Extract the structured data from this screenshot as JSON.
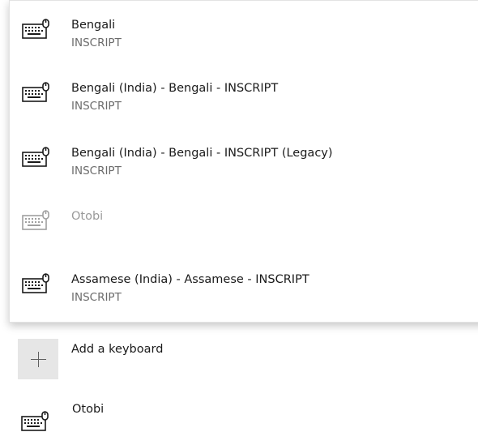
{
  "dropdown": {
    "options": [
      {
        "name": "Bengali",
        "layout": "INSCRIPT",
        "icon": "keyboard-icon",
        "enabled": true
      },
      {
        "name": "Bengali (India) - Bengali - INSCRIPT",
        "layout": "INSCRIPT",
        "icon": "keyboard-icon",
        "enabled": true
      },
      {
        "name": "Bengali (India) - Bengali - INSCRIPT (Legacy)",
        "layout": "INSCRIPT",
        "icon": "keyboard-icon",
        "enabled": true
      },
      {
        "name": "Otobi",
        "layout": "",
        "icon": "keyboard-icon",
        "enabled": false
      },
      {
        "name": "Assamese (India) - Assamese - INSCRIPT",
        "layout": "INSCRIPT",
        "icon": "keyboard-icon",
        "enabled": true
      }
    ]
  },
  "keyboards": {
    "add_label": "Add a keyboard",
    "add_icon": "plus-icon",
    "installed": [
      {
        "name": "Otobi",
        "icon": "keyboard-icon"
      }
    ]
  },
  "colors": {
    "icon_active": "#1a1a1a",
    "icon_disabled": "#a0a0a0",
    "secondary_text": "#6b6b6b",
    "tile_bg": "#e6e6e6"
  }
}
